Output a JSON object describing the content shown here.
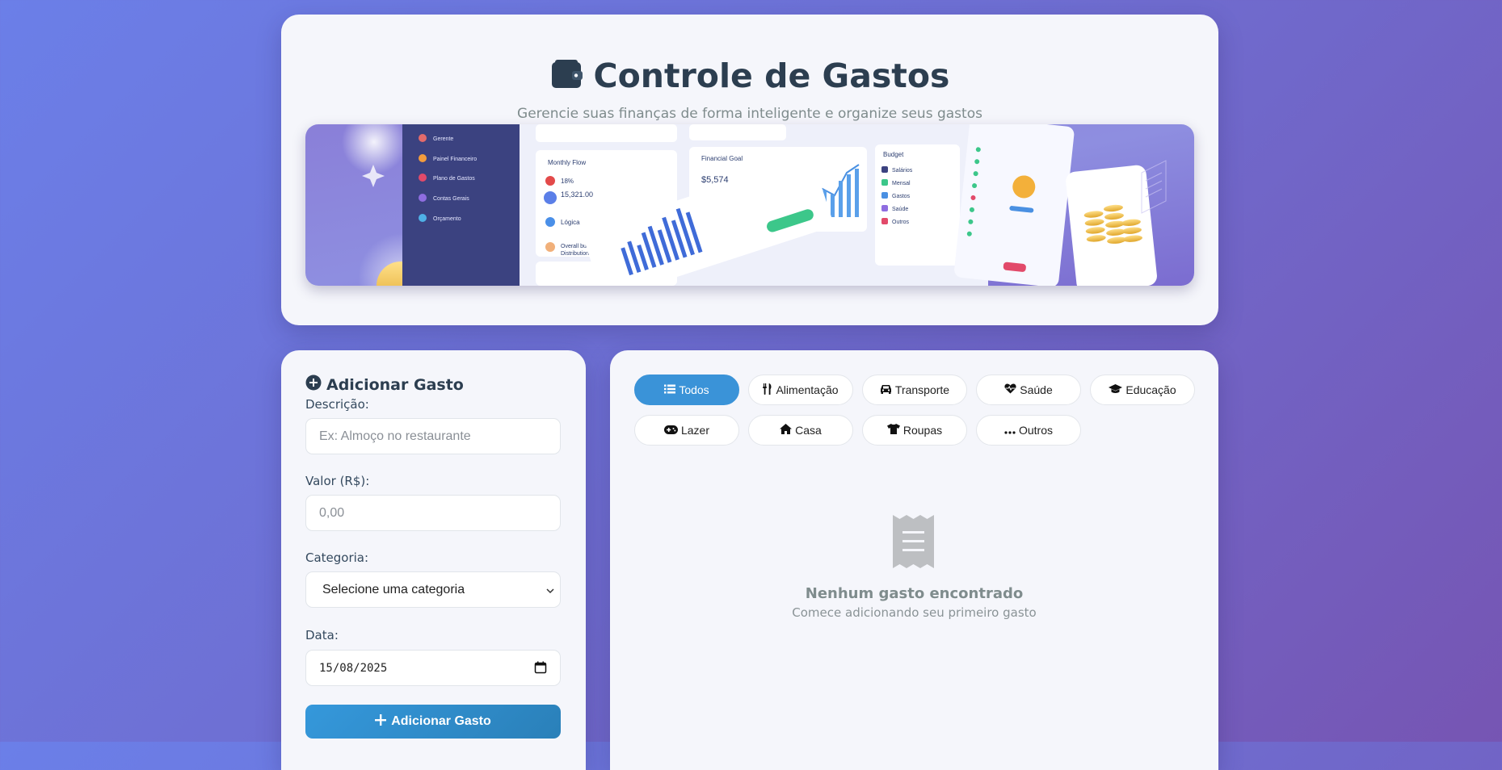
{
  "header": {
    "title": "Controle de Gastos",
    "subtitle": "Gerencie suas finanças de forma inteligente e organize seus gastos",
    "icon": "wallet-icon"
  },
  "form": {
    "title": "Adicionar Gasto",
    "description_label": "Descrição:",
    "description_placeholder": "Ex: Almoço no restaurante",
    "value_label": "Valor (R$):",
    "value_placeholder": "0,00",
    "category_label": "Categoria:",
    "category_selected": "Selecione uma categoria",
    "date_label": "Data:",
    "date_value": "15/08/2025",
    "submit_label": "Adicionar Gasto"
  },
  "filters": [
    {
      "label": "Todos",
      "icon": "list-icon",
      "active": true
    },
    {
      "label": "Alimentação",
      "icon": "utensils-icon",
      "active": false
    },
    {
      "label": "Transporte",
      "icon": "car-icon",
      "active": false
    },
    {
      "label": "Saúde",
      "icon": "heart-pulse-icon",
      "active": false
    },
    {
      "label": "Educação",
      "icon": "graduation-cap-icon",
      "active": false
    },
    {
      "label": "Lazer",
      "icon": "gamepad-icon",
      "active": false
    },
    {
      "label": "Casa",
      "icon": "home-icon",
      "active": false
    },
    {
      "label": "Roupas",
      "icon": "shirt-icon",
      "active": false
    },
    {
      "label": "Outros",
      "icon": "ellipsis-icon",
      "active": false
    }
  ],
  "empty_state": {
    "title": "Nenhum gasto encontrado",
    "subtitle": "Comece adicionando seu primeiro gasto",
    "icon": "receipt-icon"
  },
  "colors": {
    "accent": "#3a93d8",
    "title": "#2c3e50"
  }
}
